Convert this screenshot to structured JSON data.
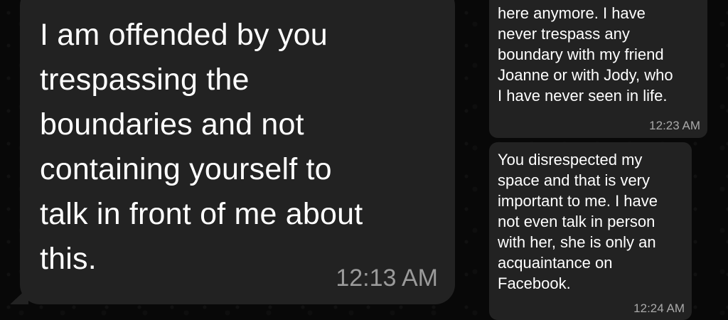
{
  "messages": [
    {
      "text": "I am offended by you\ntrespassing the\nboundaries and not\ncontaining yourself to\ntalk in front of me about\nthis.",
      "time": "12:13 AM"
    },
    {
      "text": "here anymore. I have\nnever trespass any\nboundary with my friend\nJoanne or with Jody, who\nI have never seen in life.",
      "time": "12:23 AM"
    },
    {
      "text": "You disrespected my\nspace and that is very\nimportant to me. I have\nnot even talk in person\nwith her, she is only an\nacquaintance on\nFacebook.",
      "time": "12:24 AM"
    }
  ]
}
